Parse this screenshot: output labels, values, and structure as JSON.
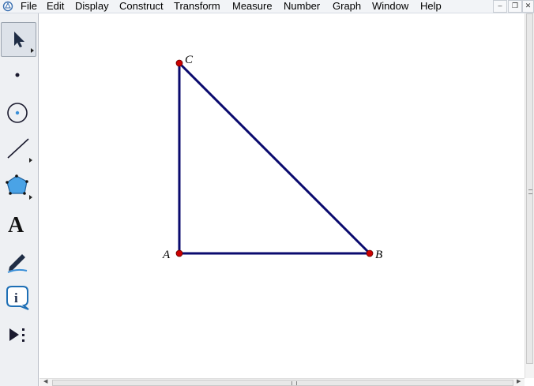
{
  "menu": {
    "items": [
      "File",
      "Edit",
      "Display",
      "Construct",
      "Transform",
      "Measure",
      "Number",
      "Graph",
      "Window",
      "Help"
    ]
  },
  "window_controls": {
    "minimize": "–",
    "restore": "❐",
    "close": "✕"
  },
  "toolbox": {
    "text_tool_glyph": "A",
    "tools": [
      {
        "name": "selection-arrow-tool",
        "icon": "arrow-icon",
        "selected": true
      },
      {
        "name": "point-tool",
        "icon": "point-icon"
      },
      {
        "name": "compass-tool",
        "icon": "circle-icon"
      },
      {
        "name": "straightedge-tool",
        "icon": "segment-icon"
      },
      {
        "name": "polygon-tool",
        "icon": "polygon-icon"
      },
      {
        "name": "text-tool",
        "icon": "text-icon"
      },
      {
        "name": "marker-tool",
        "icon": "pen-icon"
      },
      {
        "name": "information-tool",
        "icon": "info-icon"
      },
      {
        "name": "custom-tool",
        "icon": "custom-tools-icon"
      }
    ]
  },
  "sketch": {
    "points": [
      {
        "label": "A"
      },
      {
        "label": "B"
      },
      {
        "label": "C"
      }
    ],
    "segments": [
      "AB",
      "AC",
      "BC"
    ],
    "segment_color": "#0a0a6e",
    "point_color": "#cc0000"
  }
}
